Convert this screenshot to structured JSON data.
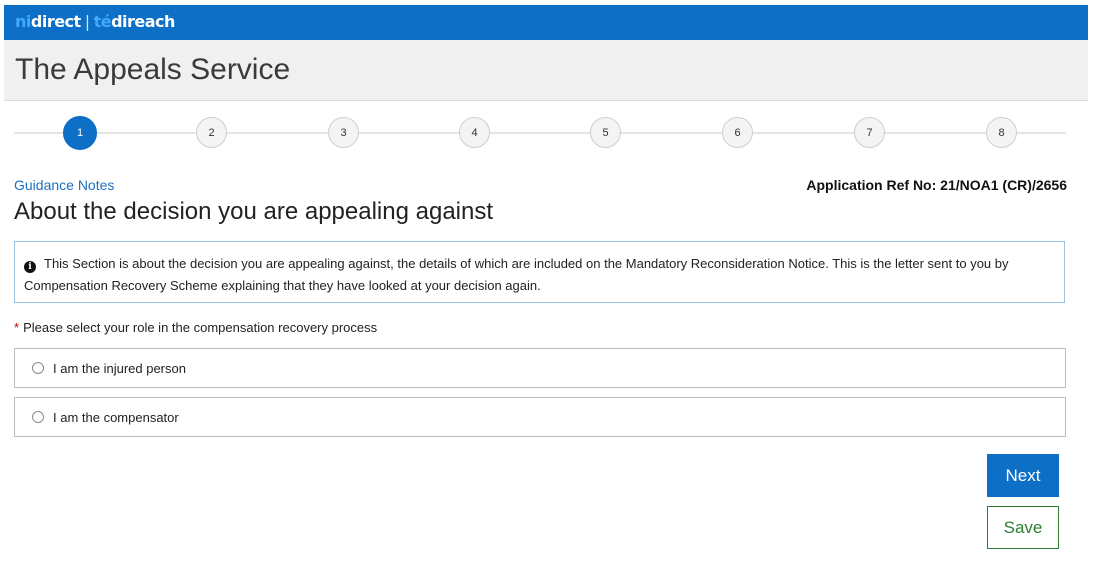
{
  "brand": {
    "logo_part1_a": "ni",
    "logo_part1_b": "direct",
    "logo_sep": "|",
    "logo_part2_a": "té",
    "logo_part2_b": "direach"
  },
  "header": {
    "title": "The Appeals Service"
  },
  "stepper": {
    "steps": [
      "1",
      "2",
      "3",
      "4",
      "5",
      "6",
      "7",
      "8"
    ],
    "current_step": 1
  },
  "links": {
    "guidance": "Guidance Notes"
  },
  "application": {
    "ref_label": "Application Ref No: 21/NOA1 (CR)/2656"
  },
  "section": {
    "title": "About the decision you are appealing against",
    "info_text": "This Section is about the decision you are appealing against, the details of which are included on the Mandatory Reconsideration Notice. This is the letter sent to you by Compensation Recovery Scheme explaining that they have looked at your decision again."
  },
  "question": {
    "required_mark": "*",
    "label": "Please select your role in the compensation recovery process",
    "options": [
      "I am the injured person",
      "I am the compensator"
    ]
  },
  "buttons": {
    "next": "Next",
    "save": "Save"
  },
  "colors": {
    "brand_blue": "#0d6fc5",
    "save_green": "#2e7d32",
    "required_red": "#c00000"
  }
}
